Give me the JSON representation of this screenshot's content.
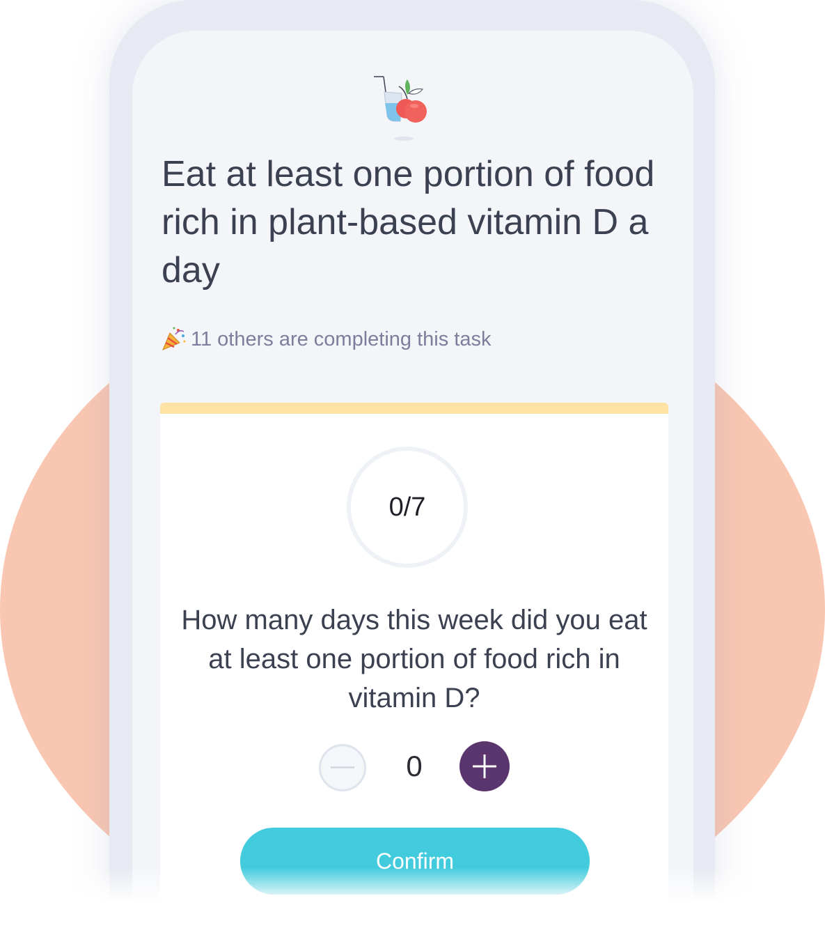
{
  "task": {
    "title": "Eat at least one portion of food rich in plant-based vitamin D a day",
    "illustration_icon": "glass-and-apple-icon",
    "social_icon": "party-popper-icon",
    "social_proof": "11 others are completing this task"
  },
  "progress": {
    "label": "0/7",
    "completed": 0,
    "total": 7
  },
  "question": {
    "text": "How many days this week did you eat at least one portion of food rich in vitamin D?"
  },
  "stepper": {
    "value": "0",
    "decrement_icon": "minus-icon",
    "increment_icon": "plus-icon"
  },
  "actions": {
    "confirm_label": "Confirm"
  },
  "colors": {
    "background_circle": "#f9c6b1",
    "card_accent": "#fde2a6",
    "increment_button": "#5b356e",
    "confirm_button": "#41cbdc"
  }
}
